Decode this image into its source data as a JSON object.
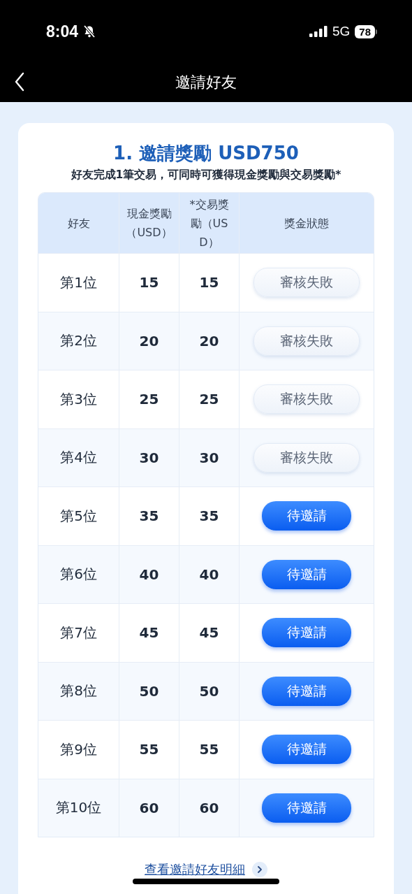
{
  "status_bar": {
    "time": "8:04",
    "network": "5G",
    "battery": "78"
  },
  "nav": {
    "title": "邀請好友"
  },
  "card": {
    "title": "1. 邀請獎勵 USD750",
    "subtitle": "好友完成1筆交易，可同時可獲得現金獎勵與交易獎勵*"
  },
  "table": {
    "columns": [
      "好友",
      "現金獎勵（USD）",
      "*交易獎勵（USD）",
      "獎金狀態"
    ],
    "rows": [
      {
        "friend": "第1位",
        "cash": "15",
        "trade": "15",
        "status": {
          "kind": "failed",
          "label": "審核失敗"
        }
      },
      {
        "friend": "第2位",
        "cash": "20",
        "trade": "20",
        "status": {
          "kind": "failed",
          "label": "審核失敗"
        }
      },
      {
        "friend": "第3位",
        "cash": "25",
        "trade": "25",
        "status": {
          "kind": "failed",
          "label": "審核失敗"
        }
      },
      {
        "friend": "第4位",
        "cash": "30",
        "trade": "30",
        "status": {
          "kind": "failed",
          "label": "審核失敗"
        }
      },
      {
        "friend": "第5位",
        "cash": "35",
        "trade": "35",
        "status": {
          "kind": "pending",
          "label": "待邀請"
        }
      },
      {
        "friend": "第6位",
        "cash": "40",
        "trade": "40",
        "status": {
          "kind": "pending",
          "label": "待邀請"
        }
      },
      {
        "friend": "第7位",
        "cash": "45",
        "trade": "45",
        "status": {
          "kind": "pending",
          "label": "待邀請"
        }
      },
      {
        "friend": "第8位",
        "cash": "50",
        "trade": "50",
        "status": {
          "kind": "pending",
          "label": "待邀請"
        }
      },
      {
        "friend": "第9位",
        "cash": "55",
        "trade": "55",
        "status": {
          "kind": "pending",
          "label": "待邀請"
        }
      },
      {
        "friend": "第10位",
        "cash": "60",
        "trade": "60",
        "status": {
          "kind": "pending",
          "label": "待邀請"
        }
      }
    ]
  },
  "details_link": "查看邀請好友明細"
}
